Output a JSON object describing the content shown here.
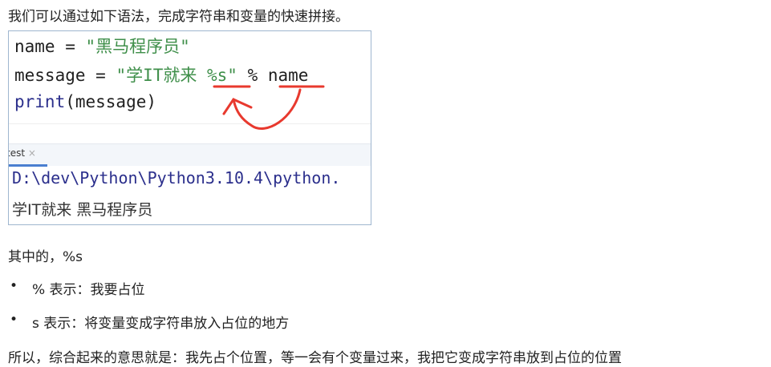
{
  "intro": "我们可以通过如下语法，完成字符串和变量的快速拼接。",
  "code": {
    "line1": {
      "var": "name = ",
      "str": "\"黑马程序员\""
    },
    "line2": {
      "var": "message = ",
      "str": "\"学IT就来 %s\"",
      "rest": " % name"
    },
    "line3": {
      "func": "print",
      "rest": "(message)"
    }
  },
  "run_tab": {
    "label": "test",
    "close": "×"
  },
  "output": [
    "D:\\dev\\Python\\Python3.10.4\\python.",
    "学IT就来 黑马程序员"
  ],
  "explain_title": "其中的，%s",
  "bullets": [
    "%  表示：我要占位",
    "s  表示：将变量变成字符串放入占位的地方"
  ],
  "summary": "所以，综合起来的意思就是：我先占个位置，等一会有个变量过来，我把它变成字符串放到占位的位置",
  "colors": {
    "string": "#3f8f4a",
    "keyword": "#2b2f8c",
    "annotation": "#e8392e",
    "output_path": "#2b2f8c"
  }
}
